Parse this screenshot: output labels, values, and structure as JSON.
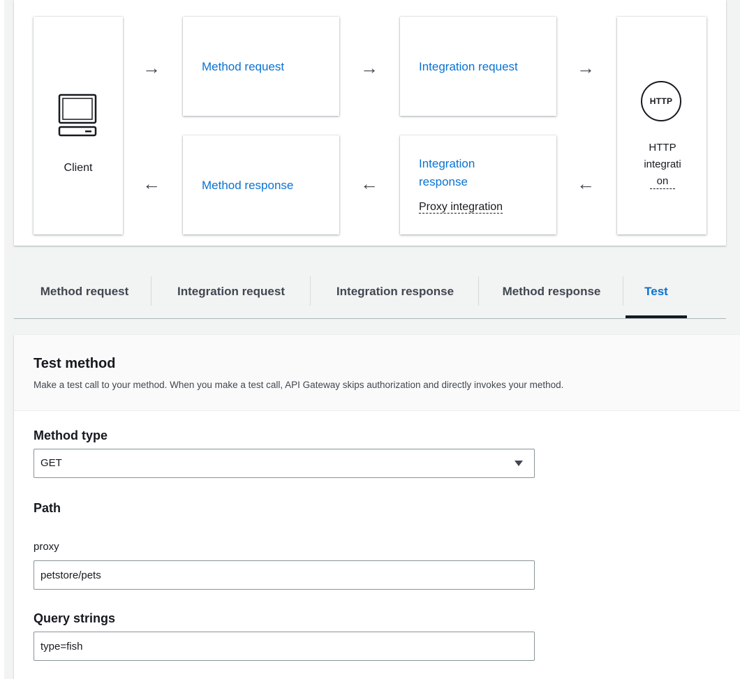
{
  "flow": {
    "client_label": "Client",
    "method_request": "Method request",
    "integration_request": "Integration request",
    "method_response": "Method response",
    "integration_response_line1": "Integration",
    "integration_response_line2": "response",
    "proxy_note": "Proxy integration",
    "http_badge": "HTTP",
    "http_label_1": "HTTP",
    "http_label_2": "integrati",
    "http_label_3": "on",
    "arrow_right": "→",
    "arrow_left": "←",
    "icons": [
      "monitor-icon",
      "http-circle-icon"
    ]
  },
  "tabs": [
    {
      "label": "Method request"
    },
    {
      "label": "Integration request"
    },
    {
      "label": "Integration response"
    },
    {
      "label": "Method response"
    },
    {
      "label": "Test",
      "active": true
    }
  ],
  "test_method": {
    "title": "Test method",
    "description": "Make a test call to your method. When you make a test call, API Gateway skips authorization and directly invokes your method.",
    "method_type_label": "Method type",
    "method_type_value": "GET",
    "path_label": "Path",
    "proxy_label": "proxy",
    "proxy_value": "petstore/pets",
    "query_label": "Query strings",
    "query_value": "type=fish"
  },
  "colors": {
    "link": "#0972d3",
    "text": "#16191f",
    "muted": "#414750",
    "background": "#f2f3f3"
  }
}
